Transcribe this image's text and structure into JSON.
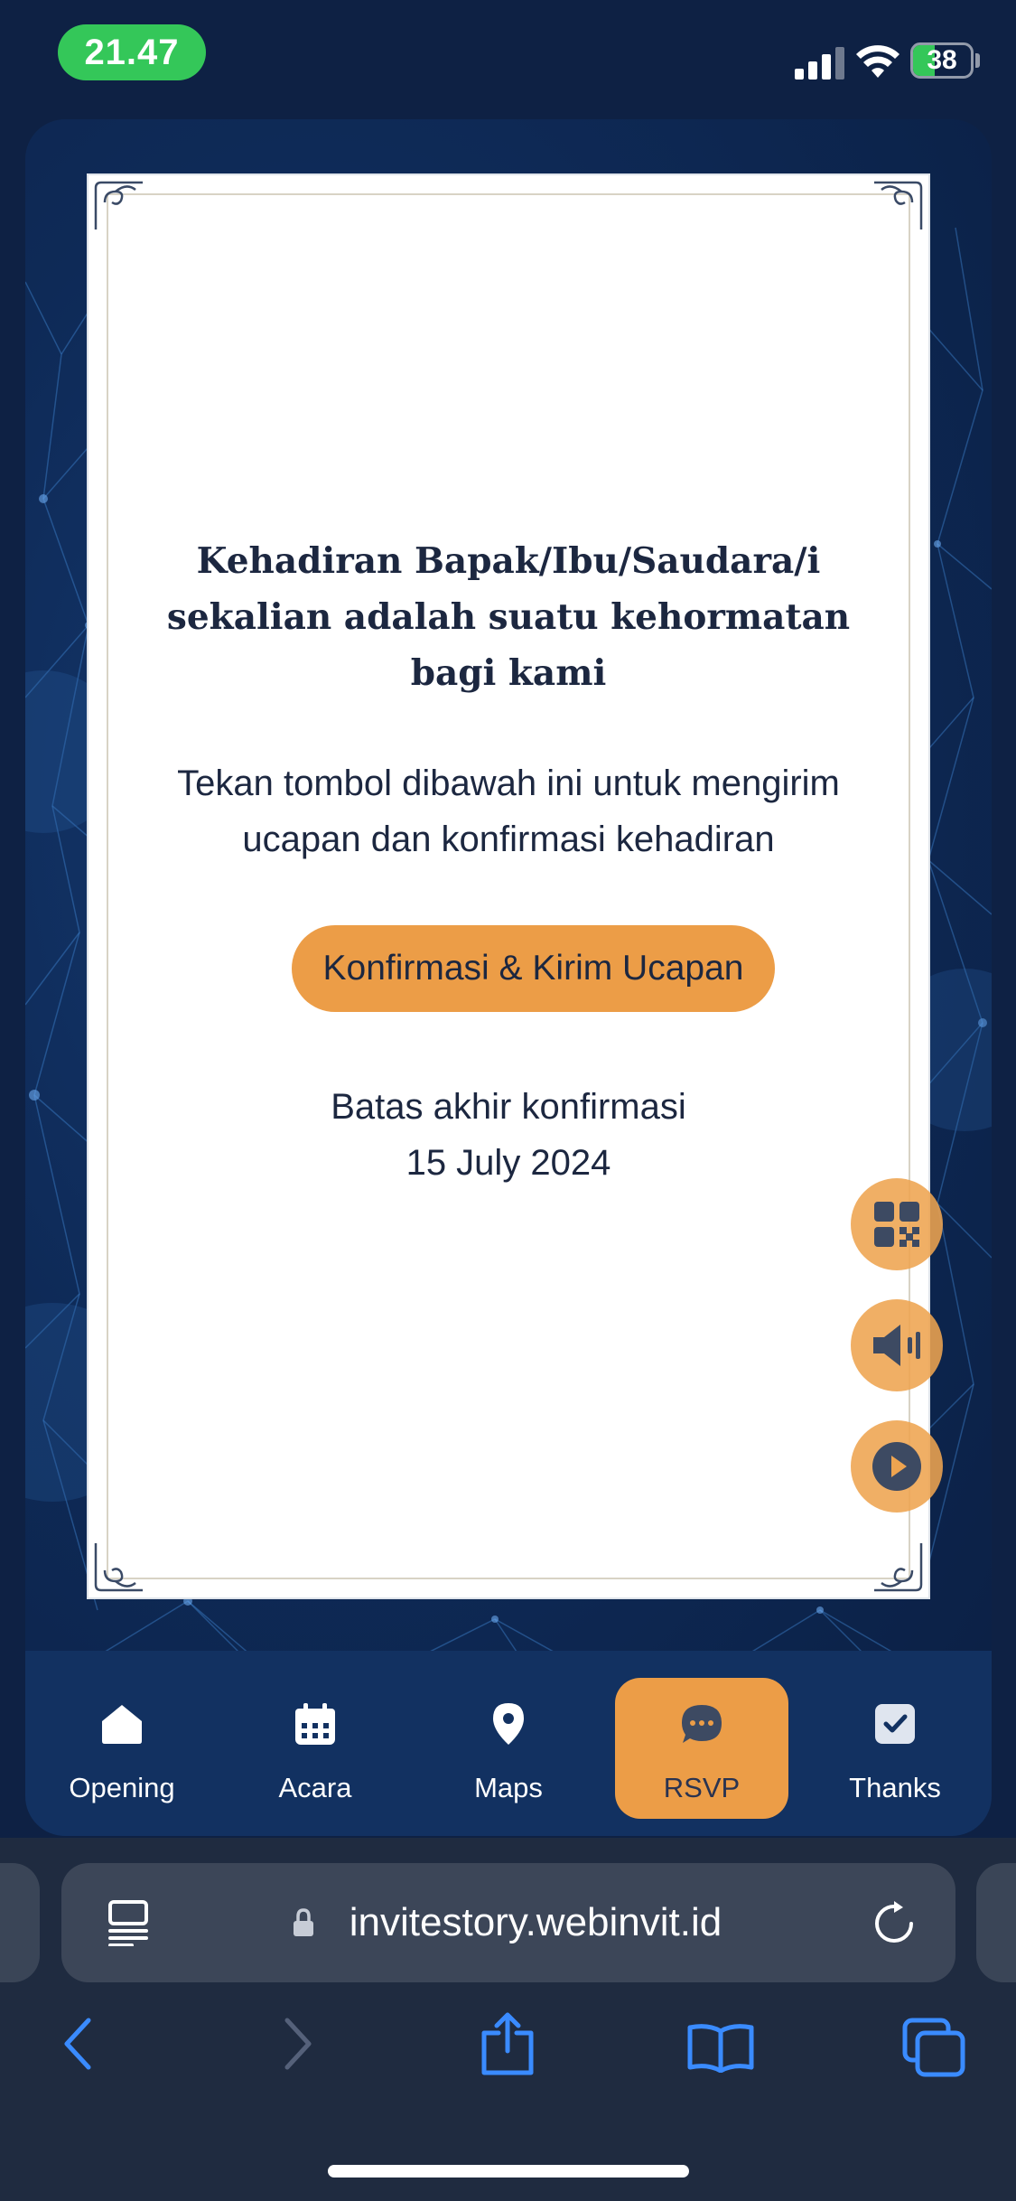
{
  "status_bar": {
    "time": "21.47",
    "battery_level": "38",
    "battery_fraction": 0.38
  },
  "invitation": {
    "headline": "Kehadiran Bapak/Ibu/Saudara/i sekalian adalah suatu kehormatan bagi kami",
    "instruction": "Tekan tombol dibawah ini untuk mengirim ucapan dan konfirmasi kehadiran",
    "confirm_button": "Konfirmasi & Kirim Ucapan",
    "deadline_label": "Batas akhir konfirmasi",
    "deadline_date": "15 July 2024"
  },
  "floating_buttons": [
    "qr-code-icon",
    "speaker-icon",
    "play-icon"
  ],
  "tabs": [
    {
      "label": "Opening",
      "icon": "home-icon",
      "active": false
    },
    {
      "label": "Acara",
      "icon": "calendar-icon",
      "active": false
    },
    {
      "label": "Maps",
      "icon": "map-pin-icon",
      "active": false
    },
    {
      "label": "RSVP",
      "icon": "chat-bubble-icon",
      "active": true
    },
    {
      "label": "Thanks",
      "icon": "checkbox-icon",
      "active": false
    }
  ],
  "browser": {
    "url": "invitestory.webinvit.id"
  },
  "colors": {
    "accent": "#ec9d47",
    "navy": "#0e2a57",
    "text": "#1c2740"
  }
}
